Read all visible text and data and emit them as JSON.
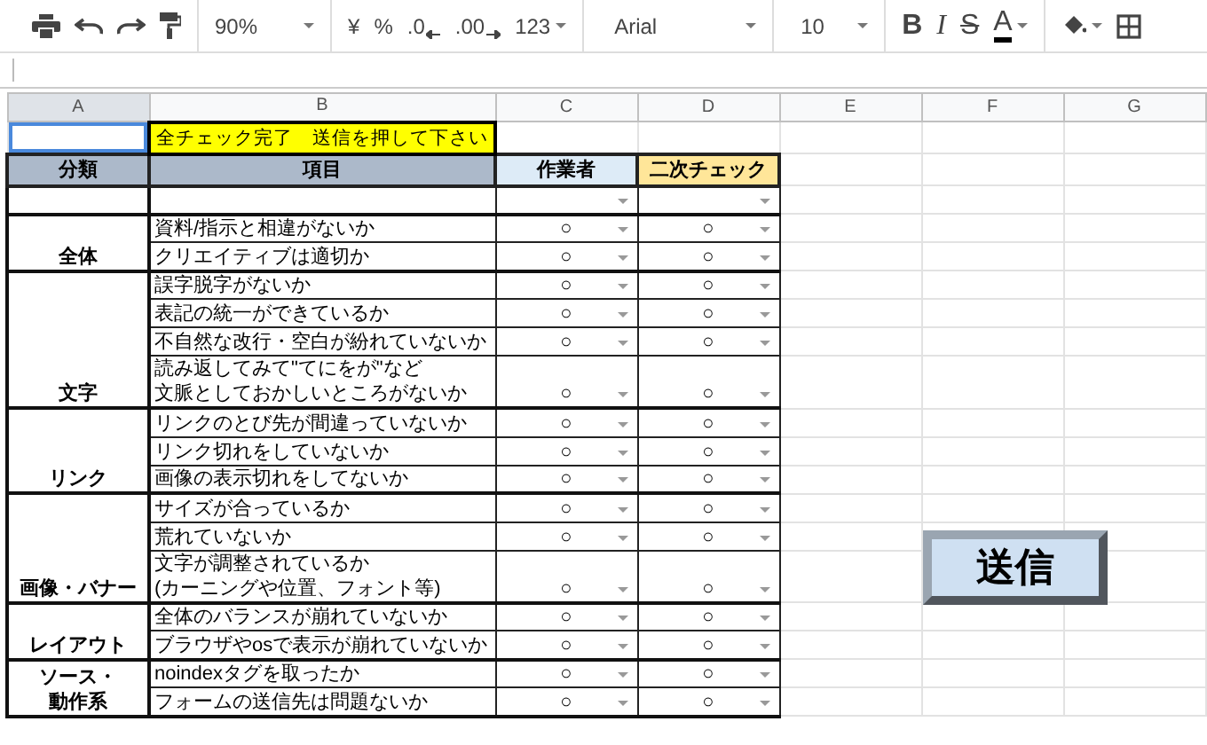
{
  "toolbar": {
    "zoom": "90%",
    "currency": "¥",
    "percent": "%",
    "decrease_decimals": ".0",
    "increase_decimals": ".00",
    "number_format": "123",
    "font": "Arial",
    "font_size": "10",
    "bold": "B",
    "italic": "I",
    "strikethrough": "S",
    "text_color": "A"
  },
  "columns": [
    "A",
    "B",
    "C",
    "D",
    "E",
    "F",
    "G"
  ],
  "notice": "全チェック完了　送信を押して下さい",
  "headers": [
    "分類",
    "項目",
    "作業者",
    "二次チェック"
  ],
  "groups": [
    {
      "category": "全体",
      "items": [
        {
          "item": "資料/指示と相違がないか",
          "worker": "○",
          "second_check": "○"
        },
        {
          "item": "クリエイティブは適切か",
          "worker": "○",
          "second_check": "○"
        }
      ]
    },
    {
      "category": "文字",
      "items": [
        {
          "item": "誤字脱字がないか",
          "worker": "○",
          "second_check": "○"
        },
        {
          "item": "表記の統一ができているか",
          "worker": "○",
          "second_check": "○"
        },
        {
          "item": "不自然な改行・空白が紛れていないか",
          "worker": "○",
          "second_check": "○"
        },
        {
          "item": [
            "読み返してみて\"てにをが\"など",
            "文脈としておかしいところがないか"
          ],
          "worker": "○",
          "second_check": "○"
        }
      ]
    },
    {
      "category": "リンク",
      "items": [
        {
          "item": "リンクのとび先が間違っていないか",
          "worker": "○",
          "second_check": "○"
        },
        {
          "item": "リンク切れをしていないか",
          "worker": "○",
          "second_check": "○"
        },
        {
          "item": "画像の表示切れをしてないか",
          "worker": "○",
          "second_check": "○"
        }
      ]
    },
    {
      "category": "画像・バナー",
      "items": [
        {
          "item": "サイズが合っているか",
          "worker": "○",
          "second_check": "○"
        },
        {
          "item": "荒れていないか",
          "worker": "○",
          "second_check": "○"
        },
        {
          "item": [
            "文字が調整されているか",
            "(カーニングや位置、フォント等)"
          ],
          "worker": "○",
          "second_check": "○"
        }
      ]
    },
    {
      "category": "レイアウト",
      "items": [
        {
          "item": "全体のバランスが崩れていないか",
          "worker": "○",
          "second_check": "○"
        },
        {
          "item": "ブラウザやosで表示が崩れていないか",
          "worker": "○",
          "second_check": "○"
        }
      ]
    },
    {
      "category": [
        "ソース・",
        "動作系"
      ],
      "items": [
        {
          "item": "noindexタグを取ったか",
          "worker": "○",
          "second_check": "○"
        },
        {
          "item": "フォームの送信先は問題ないか",
          "worker": "○",
          "second_check": "○"
        }
      ]
    }
  ],
  "send_button": "送信"
}
